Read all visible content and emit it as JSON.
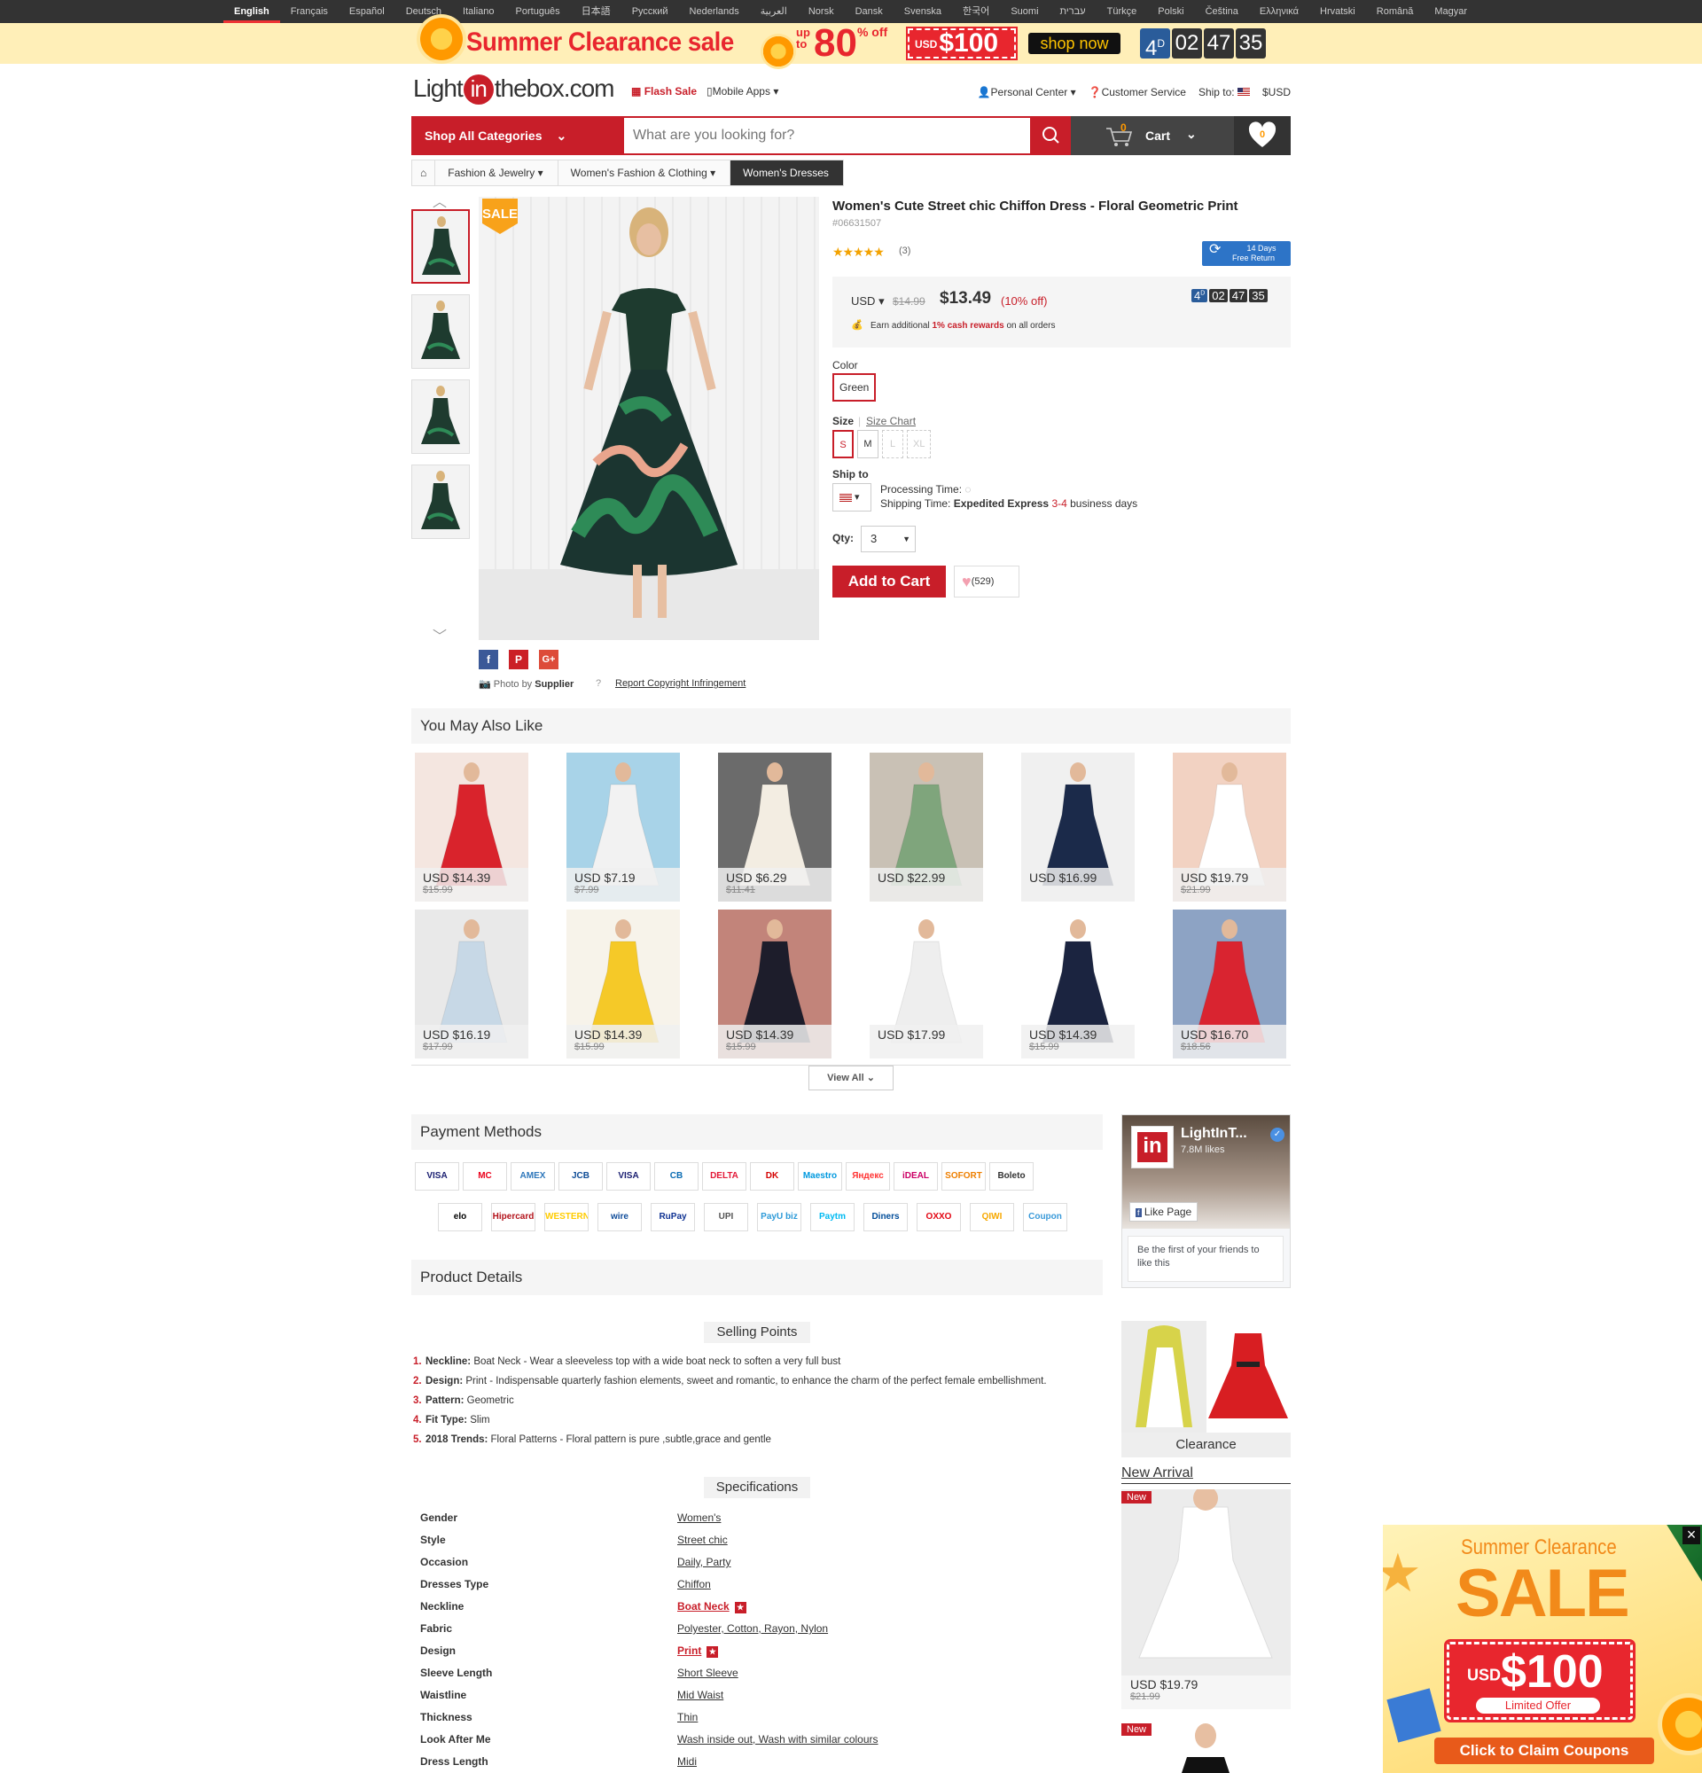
{
  "languages": [
    "English",
    "Français",
    "Español",
    "Deutsch",
    "Italiano",
    "Português",
    "日本語",
    "Русский",
    "Nederlands",
    "العربية",
    "Norsk",
    "Dansk",
    "Svenska",
    "한국어",
    "Suomi",
    "עברית",
    "Türkçe",
    "Polski",
    "Čeština",
    "Ελληνικά",
    "Hrvatski",
    "Română",
    "Magyar"
  ],
  "promo": {
    "title": "Summer Clearance sale",
    "upto": "up to",
    "percent": "80",
    "off": "% off",
    "usd_small": "USD",
    "usd_amount": "$100",
    "shop_now": "shop now",
    "countdown": {
      "days": "4",
      "days_unit": "D",
      "h": "02",
      "m": "47",
      "s": "35"
    }
  },
  "header": {
    "logo_left": "Light",
    "logo_in": "in",
    "logo_right": "thebox.com",
    "flash_sale": "Flash Sale",
    "mobile_apps": "Mobile Apps",
    "personal_center": "Personal Center",
    "customer_service": "Customer Service",
    "ship_to": "Ship to:",
    "currency": "$USD"
  },
  "search": {
    "shop_all": "Shop All Categories",
    "placeholder": "What are you looking for?",
    "cart_count": "0",
    "cart_label": "Cart",
    "wish_count": "0"
  },
  "breadcrumb": [
    "Fashion & Jewelry",
    "Women's Fashion & Clothing",
    "Women's Dresses"
  ],
  "product": {
    "sale_badge": "SALE",
    "title": "Women's Cute Street chic Chiffon Dress - Floral Geometric Print",
    "sku": "#06631507",
    "stars": "★★★★★",
    "reviews": "(3)",
    "free_return_line1": "14 Days",
    "free_return_line2": "Free Return",
    "currency": "USD",
    "old_price": "$14.99",
    "price": "$13.49",
    "discount": "(10% off)",
    "countdown": {
      "d": "4",
      "d_unit": "D",
      "h": "02",
      "m": "47",
      "s": "35"
    },
    "cash_text_pre": "Earn additional ",
    "cash_text_red": "1% cash rewards",
    "cash_text_post": " on all orders",
    "color_label": "Color",
    "color_value": "Green",
    "size_label": "Size",
    "size_chart": "Size Chart",
    "sizes": [
      "S",
      "M",
      "L",
      "XL"
    ],
    "ship_label": "Ship to",
    "processing": "Processing Time:",
    "shipping_pre": "Shipping Time: ",
    "shipping_method": "Expedited Express",
    "shipping_days": "3-4",
    "shipping_post": " business days",
    "qty_label": "Qty:",
    "qty": "3",
    "add_to_cart": "Add to Cart",
    "wish_count": "(529)",
    "photo_by": "Photo by",
    "supplier": "Supplier",
    "report": "Report Copyright Infringement"
  },
  "also_like": {
    "title": "You May Also Like",
    "items": [
      {
        "price": "USD $14.39",
        "old": "$15.99",
        "bg": "#f4e6e0",
        "dress": "#d9232c"
      },
      {
        "price": "USD $7.19",
        "old": "$7.99",
        "bg": "#a8d3e8",
        "dress": "#f2f2f2"
      },
      {
        "price": "USD $6.29",
        "old": "$11.41",
        "bg": "#6b6b6b",
        "dress": "#f3ede2"
      },
      {
        "price": "USD $22.99",
        "old": "",
        "bg": "#c9c1b5",
        "dress": "#7fa57c"
      },
      {
        "price": "USD $16.99",
        "old": "",
        "bg": "#f0f0f0",
        "dress": "#1b2a4a"
      },
      {
        "price": "USD $19.79",
        "old": "$21.99",
        "bg": "#f2d2c2",
        "dress": "#ffffff"
      },
      {
        "price": "USD $16.19",
        "old": "$17.99",
        "bg": "#e9e9e9",
        "dress": "#c7d8e6"
      },
      {
        "price": "USD $14.39",
        "old": "$15.99",
        "bg": "#f7f3ea",
        "dress": "#f5c928"
      },
      {
        "price": "USD $14.39",
        "old": "$15.99",
        "bg": "#c2847a",
        "dress": "#1d1d2b"
      },
      {
        "price": "USD $17.99",
        "old": "",
        "bg": "#ffffff",
        "dress": "#eeeeee"
      },
      {
        "price": "USD $14.39",
        "old": "$15.99",
        "bg": "#ffffff",
        "dress": "#1b2440"
      },
      {
        "price": "USD $16.70",
        "old": "$18.56",
        "bg": "#8da3c4",
        "dress": "#d92430"
      }
    ],
    "view_all": "View All"
  },
  "payment": {
    "title": "Payment Methods",
    "row1": [
      "VISA",
      "MC",
      "AMEX",
      "JCB",
      "VISA",
      "CB",
      "DELTA",
      "DK",
      "Maestro",
      "Яндекс",
      "iDEAL",
      "SOFORT",
      "Boleto"
    ],
    "row2": [
      "elo",
      "Hipercard",
      "WESTERN UNION",
      "wire transfer",
      "RuPay",
      "UPI",
      "PayU biz",
      "Paytm",
      "Diners Club",
      "OXXO",
      "QIWI WALLET",
      "Coupon"
    ]
  },
  "details": {
    "title": "Product Details",
    "selling_title": "Selling Points",
    "points": [
      {
        "n": "1.",
        "label": "Neckline:",
        "text": " Boat Neck - Wear a sleeveless top with a wide boat neck to soften a very full bust"
      },
      {
        "n": "2.",
        "label": "Design:",
        "text": " Print - Indispensable quarterly fashion elements, sweet and romantic, to enhance the charm of the perfect female embellishment."
      },
      {
        "n": "3.",
        "label": "Pattern:",
        "text": " Geometric"
      },
      {
        "n": "4.",
        "label": "Fit Type:",
        "text": " Slim"
      },
      {
        "n": "5.",
        "label": "2018 Trends:",
        "text": " Floral Patterns - Floral pattern is pure ,subtle,grace and gentle"
      }
    ],
    "spec_title": "Specifications",
    "specs": [
      {
        "k": "Gender",
        "v": "Women's"
      },
      {
        "k": "Style",
        "v": "Street chic"
      },
      {
        "k": "Occasion",
        "v": "Daily, Party"
      },
      {
        "k": "Dresses Type",
        "v": "Chiffon"
      },
      {
        "k": "Neckline",
        "v": "Boat Neck",
        "hot": true
      },
      {
        "k": "Fabric",
        "v": "Polyester, Cotton, Rayon, Nylon"
      },
      {
        "k": "Design",
        "v": "Print",
        "hot": true
      },
      {
        "k": "Sleeve Length",
        "v": "Short Sleeve"
      },
      {
        "k": "Waistline",
        "v": "Mid Waist"
      },
      {
        "k": "Thickness",
        "v": "Thin"
      },
      {
        "k": "Look After Me",
        "v": "Wash inside out, Wash with similar colours"
      },
      {
        "k": "Dress Length",
        "v": "Midi"
      }
    ]
  },
  "facebook": {
    "name": "LightInT...",
    "likes": "7.8M likes",
    "like_page": "Like Page",
    "friends": "Be the first of your friends to like this"
  },
  "sidebar": {
    "clearance": "Clearance",
    "new_arrival": "New Arrival",
    "new_badge": "New",
    "new_price": "USD $19.79",
    "new_old": "$21.99"
  },
  "popup": {
    "line1": "Summer Clearance",
    "line2": "SALE",
    "usd_small": "USD",
    "usd_amount": "$100",
    "limited": "Limited Offer",
    "claim": "Click to Claim Coupons",
    "close": "×"
  },
  "colors": {
    "brand_red": "#c81e29",
    "promo_bg": "#ffefb8",
    "dark": "#333333"
  }
}
